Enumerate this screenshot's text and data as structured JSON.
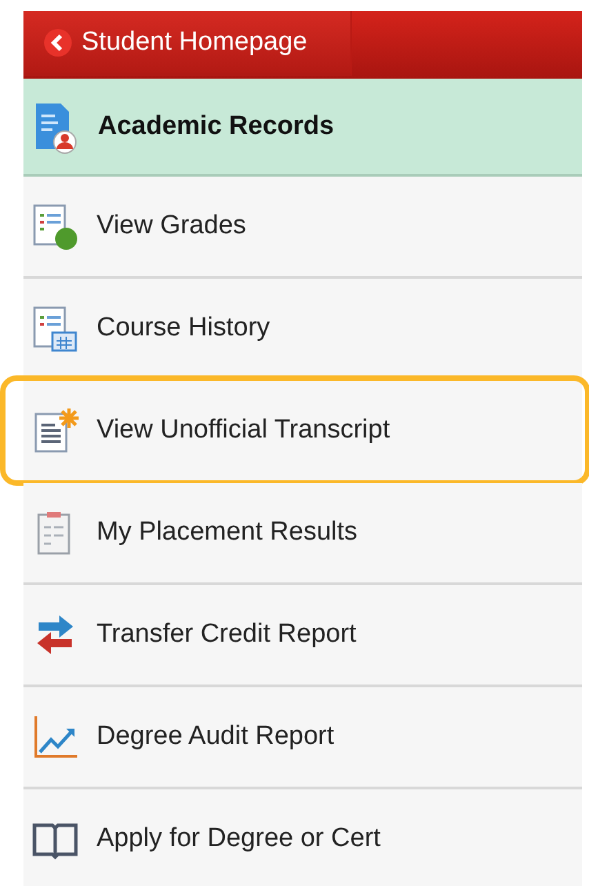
{
  "back_button": {
    "label": "Student Homepage"
  },
  "section": {
    "title": "Academic Records"
  },
  "items": [
    {
      "label": "View Grades",
      "kind": "grades",
      "highlighted": false
    },
    {
      "label": "Course History",
      "kind": "history",
      "highlighted": false
    },
    {
      "label": "View Unofficial Transcript",
      "kind": "transcript",
      "highlighted": true
    },
    {
      "label": "My Placement Results",
      "kind": "placement",
      "highlighted": false
    },
    {
      "label": "Transfer Credit Report",
      "kind": "transfer",
      "highlighted": false
    },
    {
      "label": "Degree Audit Report",
      "kind": "audit",
      "highlighted": false
    },
    {
      "label": "Apply for Degree or Cert",
      "kind": "apply",
      "highlighted": false
    }
  ]
}
